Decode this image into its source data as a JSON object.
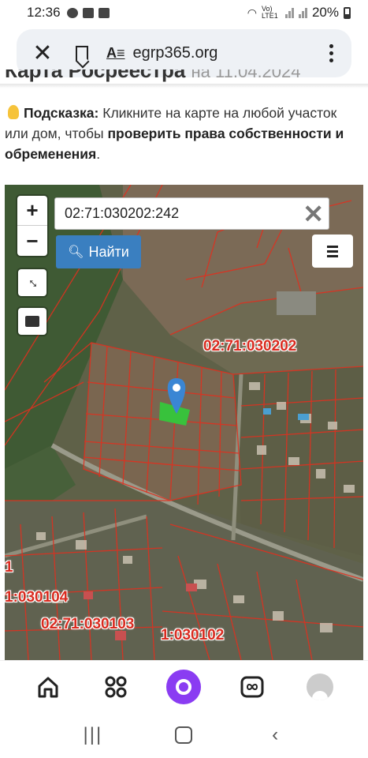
{
  "status_bar": {
    "time": "12:36",
    "network": "Vo) LTE1",
    "battery": "20%"
  },
  "browser": {
    "url": "egrp365.org"
  },
  "page": {
    "title_partial": "Карта Росреестра",
    "title_date_partial": "на 11.04.2024",
    "hint_label": "Подсказка:",
    "hint_text_1": "Кликните на карте на любой участок или дом, чтобы",
    "hint_bold": "проверить права собственности и обременения",
    "hint_end": "."
  },
  "map": {
    "zoom_in": "+",
    "zoom_out": "−",
    "search_value": "02:71:030202:242",
    "clear": "✕",
    "find_label": "Найти",
    "labels": [
      "02:71:030202",
      "02:71:030103",
      "1:030104",
      "1:030102",
      "1"
    ]
  },
  "bottom_nav": [
    "home-icon",
    "apps-icon",
    "alice-icon",
    "tabs-icon",
    "profile-icon"
  ],
  "colors": {
    "accent": "#3a7fc0",
    "cadastral": "#d92b1f",
    "alice": "#8a3cf2"
  }
}
